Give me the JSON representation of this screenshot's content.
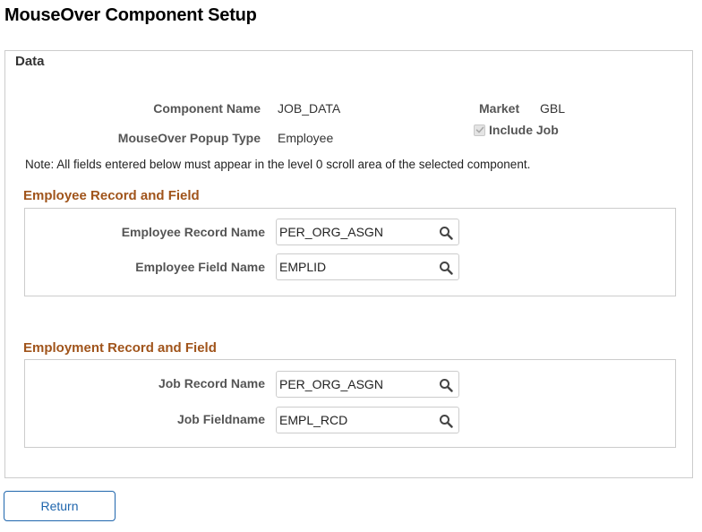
{
  "page": {
    "title": "MouseOver Component Setup"
  },
  "data_section": {
    "title": "Data",
    "component_name_label": "Component Name",
    "component_name_value": "JOB_DATA",
    "popup_type_label": "MouseOver Popup Type",
    "popup_type_value": "Employee",
    "market_label": "Market",
    "market_value": "GBL",
    "include_job_label": "Include Job",
    "include_job_checked": true,
    "note": "Note:  All fields entered below must appear in the level 0 scroll area of the selected component."
  },
  "employee_group": {
    "title": "Employee Record and Field",
    "record_label": "Employee Record Name",
    "record_value": "PER_ORG_ASGN",
    "field_label": "Employee Field Name",
    "field_value": "EMPLID"
  },
  "employment_group": {
    "title": "Employment Record and Field",
    "record_label": "Job Record Name",
    "record_value": "PER_ORG_ASGN",
    "field_label": "Job Fieldname",
    "field_value": "EMPL_RCD"
  },
  "actions": {
    "return_label": "Return"
  },
  "colors": {
    "section_title": "#a0541b",
    "button_accent": "#1f66ad"
  },
  "icons": {
    "lookup": "search-icon",
    "checkbox": "check-icon"
  }
}
